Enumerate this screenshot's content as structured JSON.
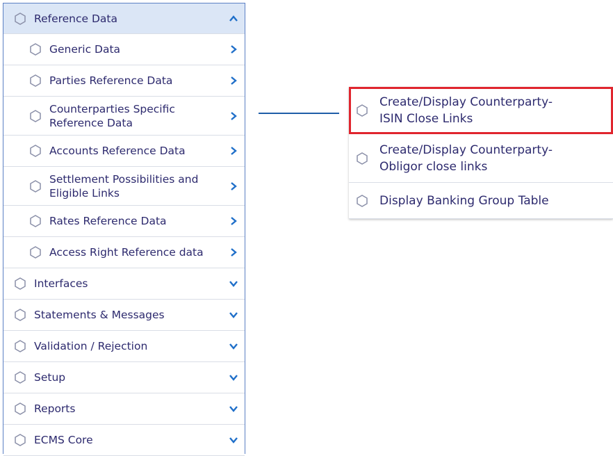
{
  "nav": {
    "section": {
      "label": "Reference Data",
      "expanded": true
    },
    "sub_items": [
      {
        "label": "Generic Data"
      },
      {
        "label": "Parties Reference Data"
      },
      {
        "label": "Counterparties Specific\nReference Data"
      },
      {
        "label": "Accounts Reference Data"
      },
      {
        "label": "Settlement Possibilities and\nEligible Links"
      },
      {
        "label": "Rates Reference Data"
      },
      {
        "label": "Access Right Reference data"
      }
    ],
    "main_items": [
      {
        "label": "Interfaces"
      },
      {
        "label": "Statements & Messages"
      },
      {
        "label": "Validation / Rejection"
      },
      {
        "label": "Setup"
      },
      {
        "label": "Reports"
      },
      {
        "label": "ECMS Core"
      }
    ]
  },
  "popup": {
    "items": [
      {
        "label": "Create/Display Counterparty-\nISIN Close Links",
        "highlighted": true
      },
      {
        "label": "Create/Display Counterparty-\nObligor close links"
      },
      {
        "label": "Display Banking Group Table"
      }
    ]
  },
  "colors": {
    "text": "#2d2a6e",
    "highlight": "#e0252e",
    "chevron": "#1f6fc9",
    "section_bg": "#dbe6f6"
  },
  "icons": {
    "item": "hexagon-icon",
    "expand": "chevron-down-icon",
    "open": "chevron-right-icon",
    "collapse": "chevron-up-icon"
  }
}
